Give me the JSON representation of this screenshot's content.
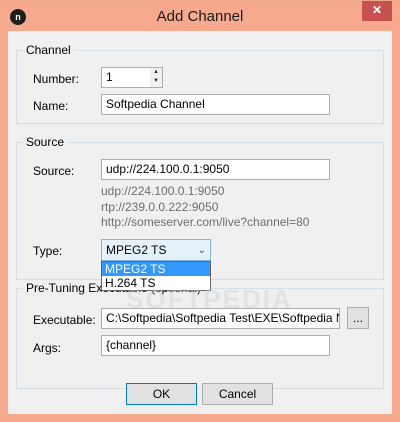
{
  "window": {
    "title": "Add Channel",
    "icon_letter": "n",
    "close_glyph": "✕"
  },
  "channel": {
    "group_title": "Channel",
    "number_label": "Number:",
    "number_value": "1",
    "name_label": "Name:",
    "name_value": "Softpedia Channel"
  },
  "source": {
    "group_title": "Source",
    "source_label": "Source:",
    "source_value": "udp://224.100.0.1:9050",
    "hints": [
      "udp://224.100.0.1:9050",
      "rtp://239.0.0.222:9050",
      "http://someserver.com/live?channel=80"
    ],
    "type_label": "Type:",
    "type_value": "MPEG2 TS",
    "type_options": [
      "MPEG2 TS",
      "H.264 TS"
    ]
  },
  "pretuning": {
    "group_title": "Pre-Tuning Executable (optional)",
    "exe_label": "Executable:",
    "exe_value": "C:\\Softpedia\\Softpedia Test\\EXE\\Softpedia Ne",
    "browse_label": "...",
    "args_label": "Args:",
    "args_value": "{channel}"
  },
  "buttons": {
    "ok": "OK",
    "cancel": "Cancel"
  },
  "watermark": "SOFTPEDIA",
  "colors": {
    "titlebar": "#f7a98e",
    "close": "#c75050",
    "selection": "#3399ff"
  }
}
